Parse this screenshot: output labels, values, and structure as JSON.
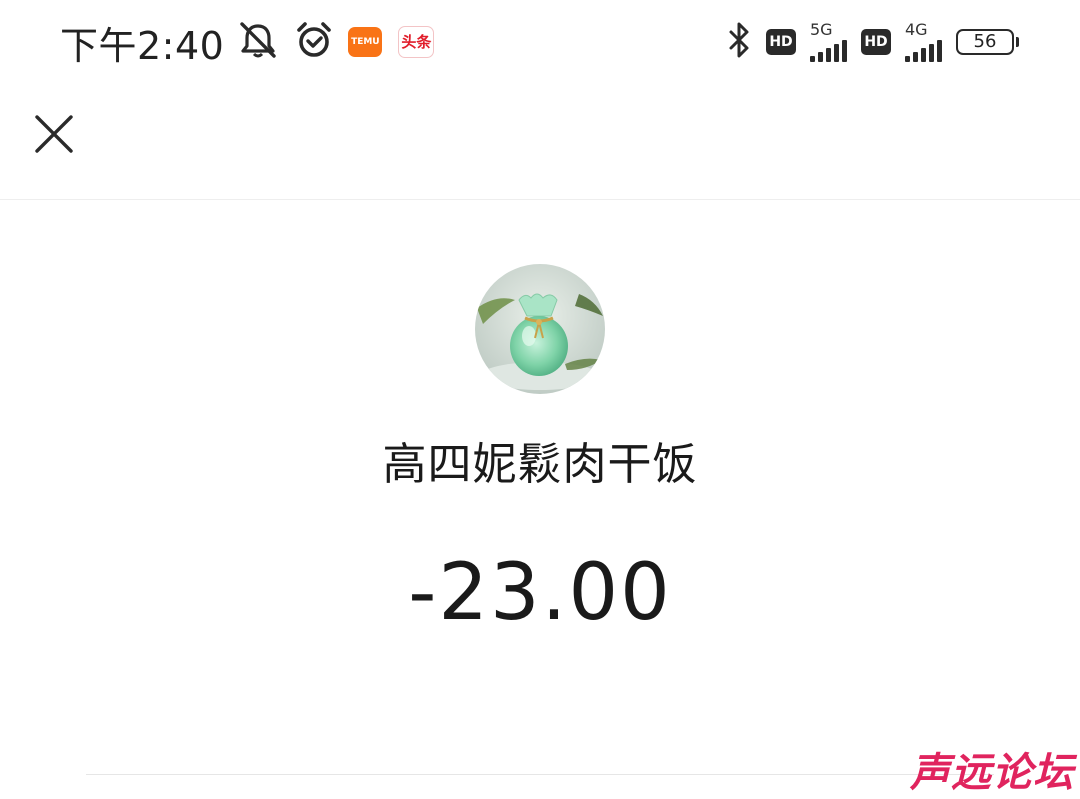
{
  "status_bar": {
    "time": "下午2:40",
    "notification_icons": [
      "mute-bell-icon",
      "alarm-clock-icon",
      "temu-app-icon",
      "toutiao-app-icon"
    ],
    "temu_label": "TEMU",
    "toutiao_label": "头条",
    "network_1": "5G",
    "network_2": "4G",
    "hd_label": "HD",
    "battery_level": "56"
  },
  "nav": {
    "close_icon": "close-icon"
  },
  "transaction": {
    "merchant_name": "高四妮鬏肉干饭",
    "amount": "-23.00"
  },
  "watermark": "声远论坛",
  "colors": {
    "background": "#ffffff",
    "text": "#1a1a1a",
    "temu_orange": "#f97316",
    "watermark_pink": "#e0245e"
  }
}
